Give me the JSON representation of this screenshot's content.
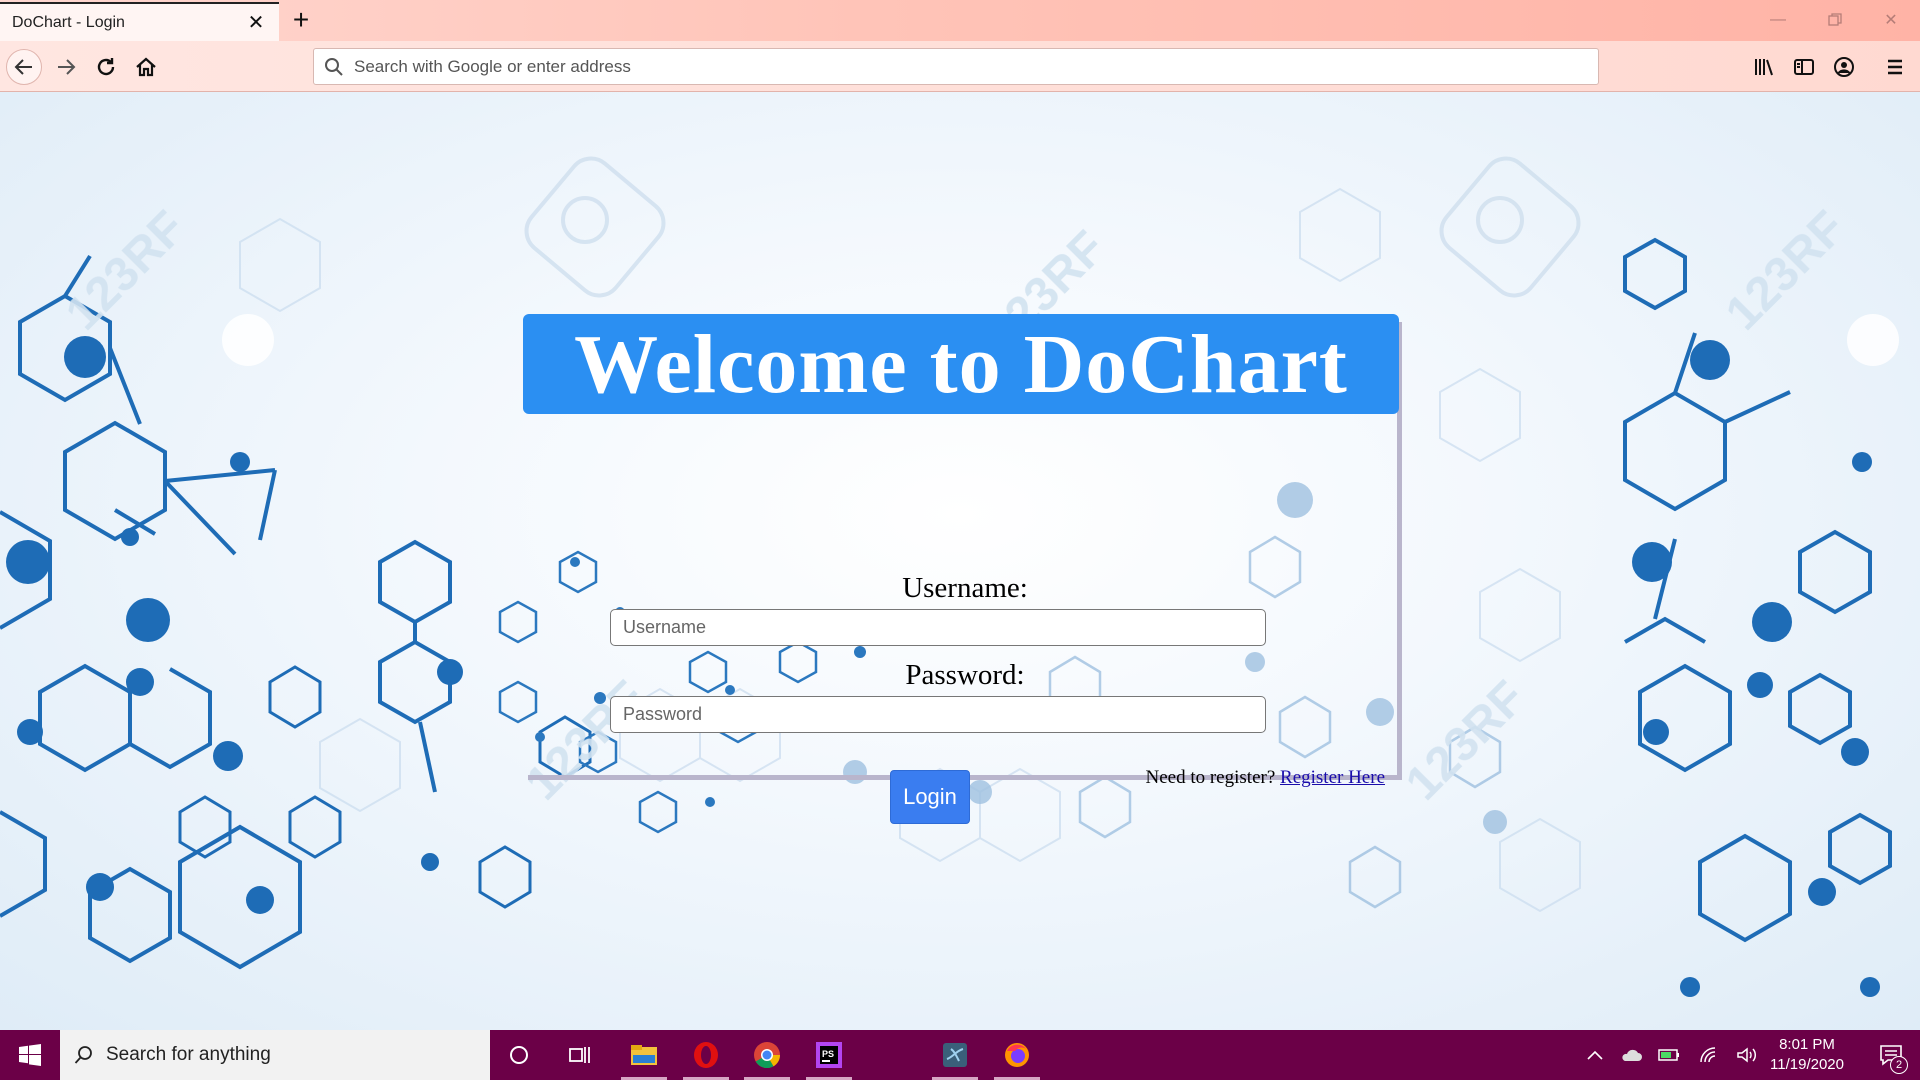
{
  "browser": {
    "tab_title": "DoChart - Login",
    "url_placeholder": "Search with Google or enter address",
    "accent_color": "#ffc4b8"
  },
  "page": {
    "banner_title": "Welcome to DoChart",
    "banner_color": "#2b8ff2",
    "username_label": "Username:",
    "username_placeholder": "Username",
    "password_label": "Password:",
    "password_placeholder": "Password",
    "login_label": "Login",
    "register_prompt": "Need to register?",
    "register_link": "Register Here"
  },
  "taskbar": {
    "search_placeholder": "Search for anything",
    "time": "8:01 PM",
    "date": "11/19/2020",
    "notification_count": "2",
    "color": "#6b0047"
  }
}
